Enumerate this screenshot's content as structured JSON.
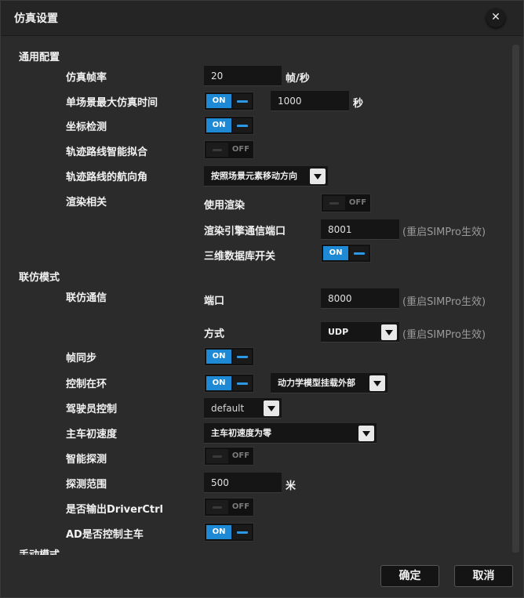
{
  "dialog": {
    "title": "仿真设置",
    "close_glyph": "✕"
  },
  "sections": {
    "general": "通用配置",
    "cosim": "联仿模式",
    "manual": "手动模式"
  },
  "general": {
    "frame_rate": {
      "label": "仿真帧率",
      "value": "20",
      "unit": "帧/秒"
    },
    "max_time": {
      "label": "单场景最大仿真时间",
      "toggle": "ON",
      "value": "1000",
      "unit": "秒"
    },
    "coord_check": {
      "label": "坐标检测",
      "toggle": "ON"
    },
    "track_fit": {
      "label": "轨迹路线智能拟合",
      "toggle": "OFF"
    },
    "heading": {
      "label": "轨迹路线的航向角",
      "selected": "按照场景元素移动方向"
    },
    "render": {
      "label": "渲染相关",
      "use_render": {
        "label": "使用渲染",
        "toggle": "OFF"
      },
      "port": {
        "label": "渲染引擎通信端口",
        "value": "8001",
        "hint": "(重启SIMPro生效)"
      },
      "db_switch": {
        "label": "三维数据库开关",
        "toggle": "ON"
      }
    }
  },
  "cosim": {
    "comm": {
      "label": "联仿通信",
      "port": {
        "label": "端口",
        "value": "8000",
        "hint": "(重启SIMPro生效)"
      },
      "mode": {
        "label": "方式",
        "selected": "UDP",
        "hint": "(重启SIMPro生效)"
      }
    },
    "frame_sync": {
      "label": "帧同步",
      "toggle": "ON"
    },
    "control_loop": {
      "label": "控制在环",
      "toggle": "ON",
      "selected": "动力学模型挂载外部"
    },
    "driver_control": {
      "label": "驾驶员控制",
      "selected": "default"
    },
    "init_speed": {
      "label": "主车初速度",
      "selected": "主车初速度为零"
    },
    "smart_detect": {
      "label": "智能探测",
      "toggle": "OFF"
    },
    "detect_range": {
      "label": "探测范围",
      "value": "500",
      "unit": "米"
    },
    "output_driverctrl": {
      "label": "是否输出DriverCtrl",
      "toggle": "OFF"
    },
    "ad_control": {
      "label": "AD是否控制主车",
      "toggle": "ON"
    }
  },
  "footer": {
    "ok": "确定",
    "cancel": "取消"
  }
}
